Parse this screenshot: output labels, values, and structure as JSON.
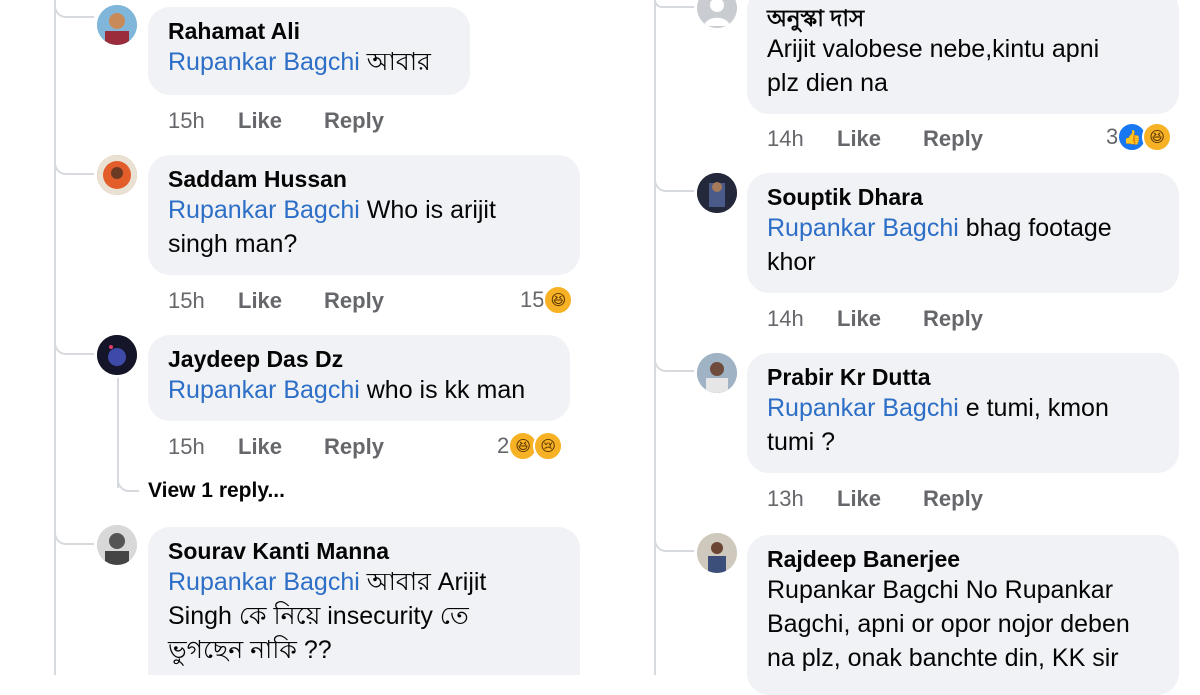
{
  "left": {
    "comments": [
      {
        "author": "Rahamat Ali",
        "mention": "Rupankar Bagchi",
        "text_lines": [
          " আবার"
        ],
        "time": "15h",
        "like": "Like",
        "reply": "Reply"
      },
      {
        "author": "Saddam Hussan",
        "mention": "Rupankar Bagchi",
        "text_lines": [
          " Who is arijit",
          "singh man?"
        ],
        "time": "15h",
        "like": "Like",
        "reply": "Reply",
        "reactions_count": "15"
      },
      {
        "author": "Jaydeep Das Dz",
        "mention": "Rupankar Bagchi",
        "text_lines": [
          " who is kk man"
        ],
        "time": "15h",
        "like": "Like",
        "reply": "Reply",
        "reactions_count": "2"
      },
      {
        "author": "Sourav Kanti Manna",
        "mention": "Rupankar Bagchi",
        "text_lines": [
          " আবার Arijit",
          "Singh কে নিয়ে insecurity তে",
          "ভুগছেন নাকি ??"
        ]
      }
    ],
    "view_replies": "View 1 reply..."
  },
  "right": {
    "comments": [
      {
        "author": "অনুস্কা দাস",
        "text_lines": [
          "Arijit valobese nebe,kintu apni",
          "plz dien na"
        ],
        "time": "14h",
        "like": "Like",
        "reply": "Reply",
        "reactions_count": "3"
      },
      {
        "author": "Souptik Dhara",
        "mention": "Rupankar Bagchi",
        "text_lines": [
          " bhag footage",
          "khor"
        ],
        "time": "14h",
        "like": "Like",
        "reply": "Reply"
      },
      {
        "author": "Prabir Kr Dutta",
        "mention": "Rupankar Bagchi",
        "text_lines": [
          " e tumi, kmon",
          "tumi ?"
        ],
        "time": "13h",
        "like": "Like",
        "reply": "Reply"
      },
      {
        "author": "Rajdeep Banerjee",
        "text_lines": [
          "Rupankar Bagchi No Rupankar",
          "Bagchi, apni or opor nojor deben",
          "na plz, onak banchte din, KK sir"
        ]
      }
    ]
  },
  "colors": {
    "mention": "#2d6ec7",
    "bubble": "#f0f2f5",
    "meta": "#65676b",
    "rail": "#d6d9dd"
  },
  "icons": {
    "haha": "haha-emoji-icon",
    "sad": "sad-emoji-icon",
    "like": "like-reaction-icon"
  }
}
